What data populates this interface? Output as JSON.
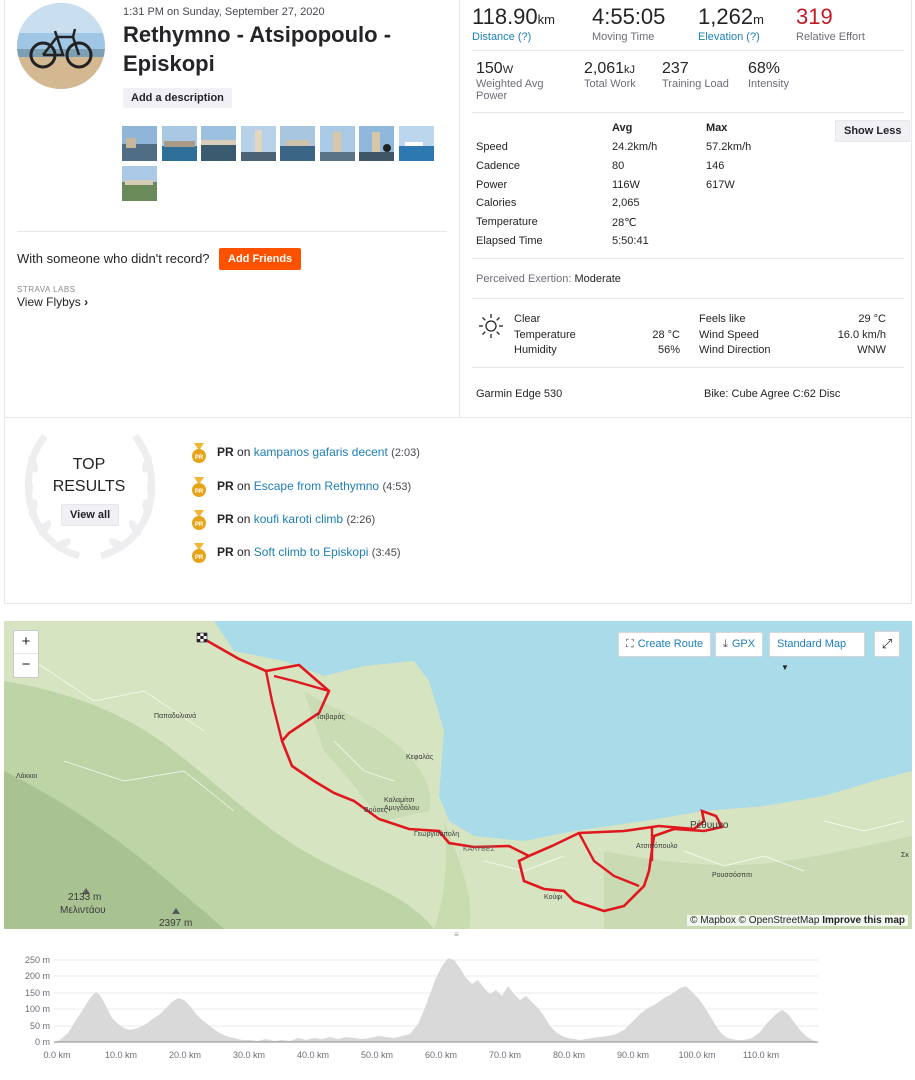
{
  "activity": {
    "date_line": "1:31 PM on Sunday, September 27, 2020",
    "title": "Rethymno - Atsipopoulo - Episkopi",
    "add_description": "Add a description",
    "with_someone": "With someone who didn't record?",
    "add_friends": "Add Friends",
    "labs_caption": "STRAVA LABS",
    "view_flybys": "View Flybys"
  },
  "primary_stats": [
    {
      "value": "118.90",
      "unit": "km",
      "label": "Distance (?)",
      "link": true
    },
    {
      "value": "4:55:05",
      "unit": "",
      "label": "Moving Time",
      "link": false
    },
    {
      "value": "1,262",
      "unit": "m",
      "label": "Elevation (?)",
      "link": true
    },
    {
      "value": "319",
      "unit": "",
      "label": "Relative Effort",
      "link": false
    }
  ],
  "secondary_stats": [
    {
      "value": "150",
      "unit": "W",
      "label1": "Weighted Avg",
      "label2": "Power"
    },
    {
      "value": "2,061",
      "unit": "kJ",
      "label1": "Total Work",
      "label2": ""
    },
    {
      "value": "237",
      "unit": "",
      "label1": "Training Load",
      "label2": ""
    },
    {
      "value": "68%",
      "unit": "",
      "label1": "Intensity",
      "label2": ""
    }
  ],
  "details_table": {
    "avg_header": "Avg",
    "max_header": "Max",
    "show_less": "Show Less",
    "rows": [
      {
        "label": "Speed",
        "avg": "24.2km/h",
        "max": "57.2km/h"
      },
      {
        "label": "Cadence",
        "avg": "80",
        "max": "146"
      },
      {
        "label": "Power",
        "avg": "116W",
        "max": "617W"
      },
      {
        "label": "Calories",
        "avg": "2,065",
        "max": ""
      },
      {
        "label": "Temperature",
        "avg": "28℃",
        "max": ""
      },
      {
        "label": "Elapsed Time",
        "avg": "5:50:41",
        "max": ""
      }
    ]
  },
  "exertion": {
    "label": "Perceived Exertion:",
    "value": "Moderate"
  },
  "weather": {
    "condition": "Clear",
    "temperature_label": "Temperature",
    "temperature": "28 °C",
    "humidity_label": "Humidity",
    "humidity": "56%",
    "feels_like_label": "Feels like",
    "feels_like": "29 °C",
    "wind_speed_label": "Wind Speed",
    "wind_speed": "16.0 km/h",
    "wind_dir_label": "Wind Direction",
    "wind_dir": "WNW"
  },
  "gear": {
    "device": "Garmin Edge 530",
    "bike": "Bike: Cube Agree C:62 Disc"
  },
  "results": {
    "title_line1": "TOP",
    "title_line2": "RESULTS",
    "view_all": "View all",
    "items": [
      {
        "badge": "PR",
        "prefix": "PR",
        "on": "on",
        "segment": "kampanos gafaris decent",
        "time": "(2:03)"
      },
      {
        "badge": "PR",
        "prefix": "PR",
        "on": "on",
        "segment": "Escape from Rethymno",
        "time": "(4:53)"
      },
      {
        "badge": "PR",
        "prefix": "PR",
        "on": "on",
        "segment": "koufi karoti climb",
        "time": "(2:26)"
      },
      {
        "badge": "PR",
        "prefix": "PR",
        "on": "on",
        "segment": "Soft climb to Episkopi",
        "time": "(3:45)"
      }
    ]
  },
  "map": {
    "zoom_in": "+",
    "zoom_out": "−",
    "create_route": "Create Route",
    "gpx": "GPX",
    "map_type": "Standard Map",
    "attribution_1": "© Mapbox © OpenStreetMap",
    "attribution_2": "Improve this map",
    "route_color": "#e0171e",
    "places": [
      "Παπαδολιανά",
      "Λάκκοι",
      "Τσιβαράς",
      "Κεφαλάς",
      "Καλαμίτσι Αμυγδάλου",
      "Βρύσες",
      "Γεωργιούπολη",
      "ΚΑΛΥΒΕΣ",
      "Ρέθυμνο",
      "Ατσιπόπουλο",
      "Κούφι",
      "Ρουσσόσπιτι",
      "Σκ",
      "2133 m",
      "Μελιντάου",
      "2397 m"
    ]
  },
  "elevation": {
    "y_ticks": [
      "250 m",
      "200 m",
      "150 m",
      "100 m",
      "50 m",
      "0 m"
    ],
    "x_ticks": [
      "0.0 km",
      "10.0 km",
      "20.0 km",
      "30.0 km",
      "40.0 km",
      "50.0 km",
      "60.0 km",
      "70.0 km",
      "80.0 km",
      "90.0 km",
      "100.0 km",
      "110.0 km"
    ],
    "fill_color": "#d9d9d9"
  }
}
